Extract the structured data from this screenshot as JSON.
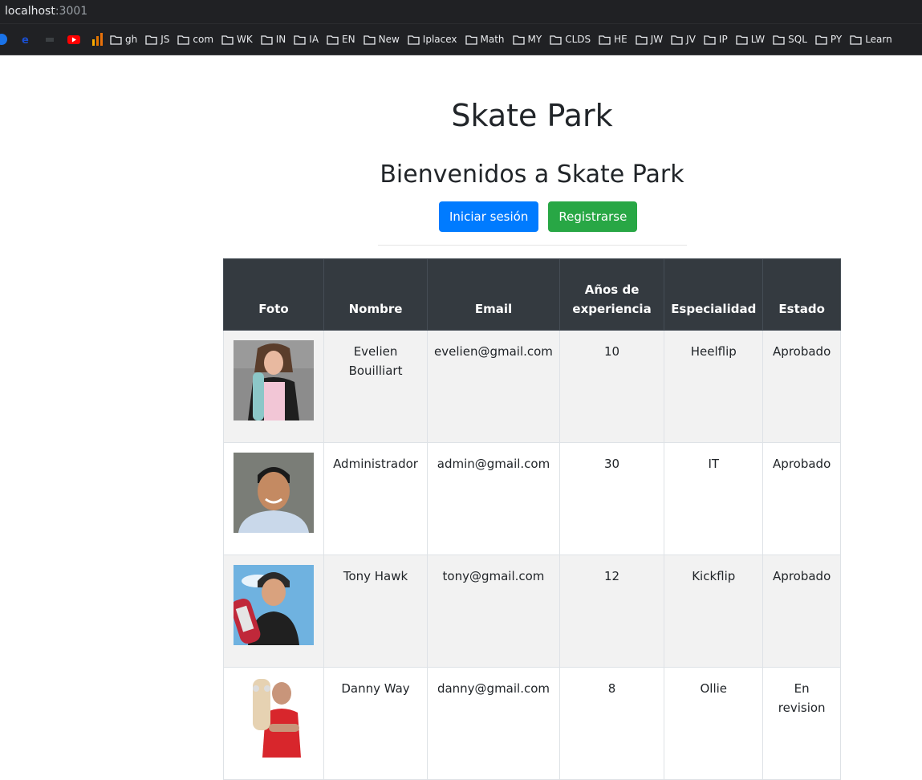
{
  "browser": {
    "host": "localhost",
    "port": ":3001",
    "bookmarks": [
      "gh",
      "JS",
      "com",
      "WK",
      "IN",
      "IA",
      "EN",
      "New",
      "Iplacex",
      "Math",
      "MY",
      "CLDS",
      "HE",
      "JW",
      "JV",
      "IP",
      "LW",
      "SQL",
      "PY",
      "Learn"
    ]
  },
  "page": {
    "title": "Skate Park",
    "subtitle": "Bienvenidos a Skate Park",
    "login_label": "Iniciar sesión",
    "register_label": "Registrarse"
  },
  "table": {
    "headers": [
      "Foto",
      "Nombre",
      "Email",
      "Años de experiencia",
      "Especialidad",
      "Estado"
    ],
    "rows": [
      {
        "nombre": "Evelien Bouilliart",
        "email": "evelien@gmail.com",
        "experiencia": "10",
        "especialidad": "Heelflip",
        "estado": "Aprobado",
        "photo": "skater-woman-photo"
      },
      {
        "nombre": "Administrador",
        "email": "admin@gmail.com",
        "experiencia": "30",
        "especialidad": "IT",
        "estado": "Aprobado",
        "photo": "admin-man-photo"
      },
      {
        "nombre": "Tony Hawk",
        "email": "tony@gmail.com",
        "experiencia": "12",
        "especialidad": "Kickflip",
        "estado": "Aprobado",
        "photo": "skater-helmet-photo"
      },
      {
        "nombre": "Danny Way",
        "email": "danny@gmail.com",
        "experiencia": "8",
        "especialidad": "Ollie",
        "estado": "En revision",
        "photo": "skater-red-shirt-photo"
      }
    ]
  },
  "colors": {
    "primary": "#007bff",
    "success": "#28a745",
    "table_header": "#343a40"
  }
}
